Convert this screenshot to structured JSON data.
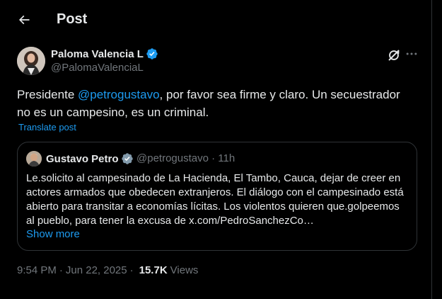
{
  "header": {
    "title": "Post",
    "back_icon": "arrow-left-icon"
  },
  "post": {
    "author_name": "Paloma Valencia L",
    "author_handle": "@PalomaValenciaL",
    "verified_icon": "verified-badge-icon",
    "text_before": "Presidente ",
    "mention": "@petrogustavo",
    "text_after": ", por favor sea firme y claro. Un secuestrador no es un campesino, es un criminal.",
    "translate_label": "Translate post",
    "time": "9:54 PM",
    "date": "Jun 22, 2025",
    "separator": "·",
    "views_count": "15.7K",
    "views_label": "Views"
  },
  "quote": {
    "author_name": "Gustavo Petro",
    "author_handle": "@petrogustavo · 11h",
    "text": "Le.solicito al campesinado de La Hacienda, El Tambo, Cauca, dejar de creer en actores armados que obedecen extranjeros. El diálogo con el campesinado está abierto para transitar a economías lícitas. Los violentos quieren que.golpeemos al pueblo, para tener la excusa de x.com/PedroSanchezCo…",
    "show_more_label": "Show more"
  },
  "colors": {
    "background": "#000000",
    "text": "#e7e9ea",
    "secondary": "#71767b",
    "accent": "#1d9bf0",
    "border": "#2f3336",
    "verified_blue": "#1d9bf0",
    "verified_gray": "#829aab"
  }
}
